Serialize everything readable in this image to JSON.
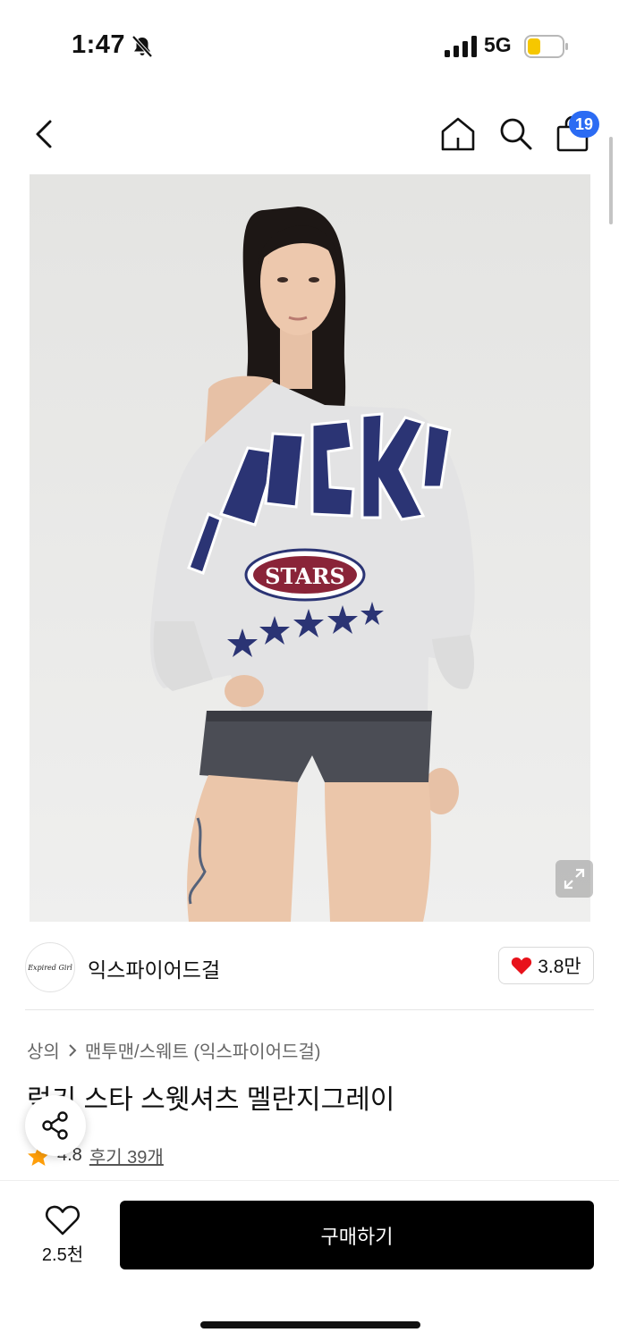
{
  "status_bar": {
    "time": "1:47",
    "network": "5G",
    "silent_mode": true
  },
  "nav": {
    "cart_count": "19"
  },
  "brand": {
    "name": "익스파이어드걸",
    "logo_text": "Expired Girl",
    "likes": "3.8만"
  },
  "breadcrumb": {
    "category": "상의",
    "subcategory": "맨투맨/스웨트 (익스파이어드걸)"
  },
  "product": {
    "title": "럭키 스타 스웻셔츠 멜란지그레이",
    "rating": "4.8",
    "reviews": "후기 39개"
  },
  "bottom": {
    "wish_count": "2.5천",
    "buy_label": "구매하기"
  },
  "photo": {
    "shirt_text": "STARS",
    "shirt_arc": "LUCKY"
  },
  "colors": {
    "accent_badge": "#2b6bf3",
    "heart": "#e8121b",
    "star": "#ff9f0a",
    "buy_bg": "#000000",
    "battery": "#f6c700"
  }
}
